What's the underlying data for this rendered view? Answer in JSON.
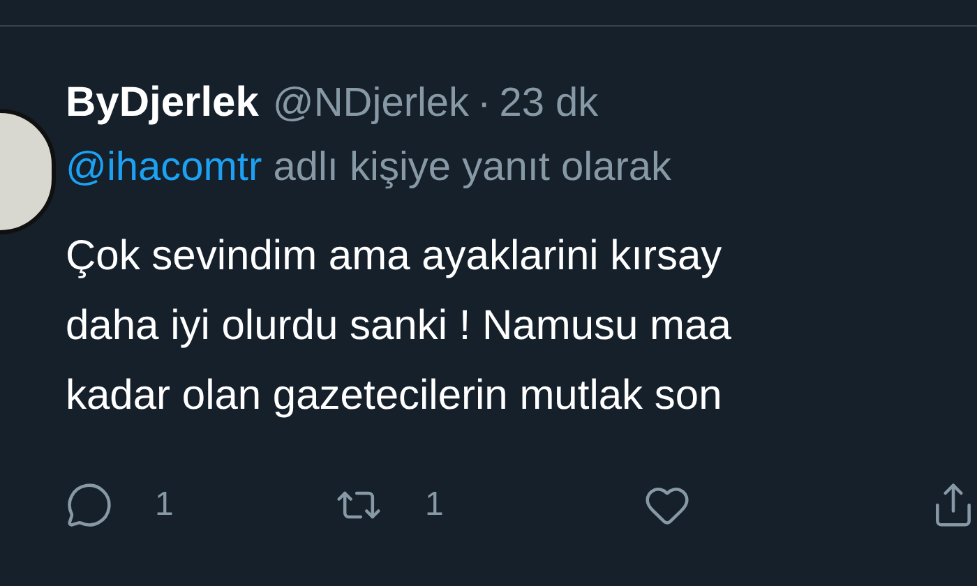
{
  "tweet": {
    "name": "ByDjerlek",
    "handle": "@NDjerlek",
    "separator": "·",
    "time": "23 dk",
    "reply_to": {
      "mention": "@ihacomtr",
      "text": "adlı kişiye yanıt olarak"
    },
    "lines": [
      "Çok sevindim ama ayaklarini kırsay",
      "daha iyi olurdu sanki ! Namusu maa",
      "kadar olan gazetecilerin mutlak son"
    ],
    "actions": [
      {
        "kind": "reply",
        "count": "1"
      },
      {
        "kind": "retweet",
        "count": "1"
      },
      {
        "kind": "like"
      },
      {
        "kind": "share"
      }
    ]
  }
}
